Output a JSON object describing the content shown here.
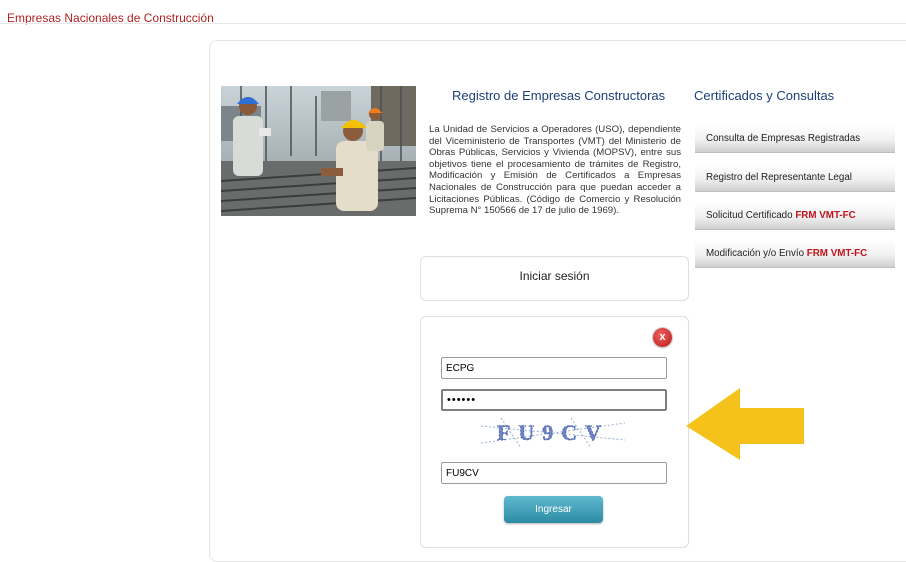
{
  "header": {
    "site_title": "Empresas Nacionales de Construcción"
  },
  "main": {
    "heading": "Registro de Empresas Constructoras",
    "description": "La Unidad de Servicios a Operadores (USO), dependiente del Viceministerio de Transportes (VMT) del Ministerio de Obras Públicas, Servicios y Vivienda (MOPSV), entre sus objetivos tiene el procesamiento de trámites de Registro, Modificación y Emisión de Certificados a Empresas Nacionales de Construcción para que puedan acceder a Licitaciones Públicas. (Código de Comercio y Resolución Suprema N° 150566 de 17 de julio de 1969)."
  },
  "sidebar": {
    "heading": "Certificados y Consultas",
    "items": [
      {
        "label": "Consulta de Empresas Registradas",
        "highlight": ""
      },
      {
        "label": "Registro del Representante Legal",
        "highlight": ""
      },
      {
        "label": "Solicitud Certificado ",
        "highlight": "FRM VMT-FC"
      },
      {
        "label": "Modificación y/o Envío ",
        "highlight": "FRM VMT-FC"
      }
    ]
  },
  "login": {
    "title": "Iniciar sesión",
    "close_label": "x",
    "username_value": "ECPG",
    "password_value": "zzzzzz",
    "captcha_text": "FU9CV",
    "captcha_value": "FU9CV",
    "submit_label": "Ingresar"
  },
  "colors": {
    "site_title": "#b22222",
    "heading_blue": "#1c3f7a",
    "highlight_red": "#c0141c",
    "button_teal": "#2c8ba3",
    "arrow_yellow": "#f5c21b"
  },
  "icons": {
    "close": "close-icon",
    "arrow": "arrow-left-icon"
  }
}
